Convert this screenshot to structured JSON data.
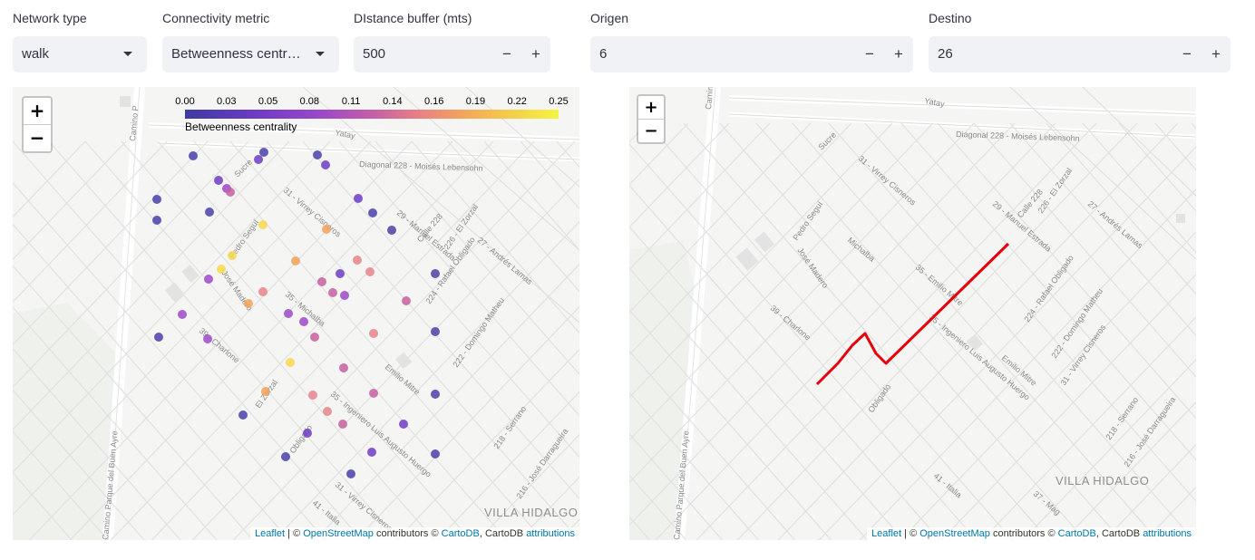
{
  "controls": {
    "network_type": {
      "label": "Network type",
      "value": "walk"
    },
    "connectivity_metric": {
      "label": "Connectivity metric",
      "value": "Betweenness centr…"
    },
    "distance_buffer": {
      "label": "DIstance buffer (mts)",
      "value": "500"
    },
    "origen": {
      "label": "Origen",
      "value": "6"
    },
    "destino": {
      "label": "Destino",
      "value": "26"
    },
    "minus": "−",
    "plus": "+"
  },
  "map_left": {
    "zoom_in": "+",
    "zoom_out": "−",
    "legend": {
      "ticks": [
        "0.00",
        "0.03",
        "0.05",
        "0.08",
        "0.11",
        "0.14",
        "0.16",
        "0.19",
        "0.22",
        "0.25"
      ],
      "caption": "Betweenness centrality"
    },
    "labels": [
      "Camino P",
      "Yatay",
      "Diagonal 228 - Moisés Lebensohn",
      "Sucre",
      "31 - Virrey Cisneros",
      "Pedro Seguí",
      "José Madero",
      "35 - Michalba",
      "Calle 228",
      "29 - Manuel Estrada",
      "226 - El Zorzal",
      "27 - Andrés Lamas",
      "224 - Rafael Obligado",
      "222 - Domingo Matheu",
      "Emilio Mitre",
      "35 - Ingeniero Luis Augusto Huergo",
      "39 - Charlone",
      "El Zorzal",
      "Obligado",
      "31 - Virrey Cisneros",
      "218 - Serrano",
      "216 - José Darragueira",
      "41 - Italia",
      "Camino Parque del Buen Ayre",
      "VILLA HIDALGO"
    ],
    "attribution": {
      "leaflet": "Leaflet",
      "sep": " | © ",
      "osm": "OpenStreetMap",
      "mid": " contributors © ",
      "carto": "CartoDB",
      "tail": ", CartoDB ",
      "attr": "attributions"
    }
  },
  "map_right": {
    "zoom_in": "+",
    "zoom_out": "−",
    "labels": [
      "Camin",
      "Yatay",
      "Diagonal 228 - Moisés Lebensohn",
      "Sucre",
      "31 - Virrey Cisneros",
      "Pedro Seguí",
      "José Madero",
      "Michalba",
      "35 - Emilio Mitre",
      "Calle 228",
      "29 - Manuel Estrada",
      "226 - El Zorzal",
      "27 - Andrés Lamas",
      "224 - Rafael Obligado",
      "222 - Domingo Matheu",
      "35 - Ingeniero Luis Augusto Huergo",
      "39 - Charlone",
      "Obligado",
      "Emilio Mitre",
      "31 - Virrey Cisneros",
      "218 - Serrano",
      "216 - José Darragueira",
      "41 - Italia",
      "37 - Mag",
      "VILLA HIDALGO",
      "Camino Parque del Buen Ayre"
    ],
    "route_color": "#e8000b",
    "attribution": {
      "leaflet": "Leaflet",
      "sep": " | © ",
      "osm": "OpenStreetMap",
      "mid": " contributors © ",
      "carto": "CartoDB",
      "tail": ", CartoDB ",
      "attr": "attributions"
    }
  },
  "colors": {
    "control_bg": "#f0f2f6",
    "text": "#31333f",
    "map_bg": "#f5f5f3",
    "link": "#0078a8"
  }
}
